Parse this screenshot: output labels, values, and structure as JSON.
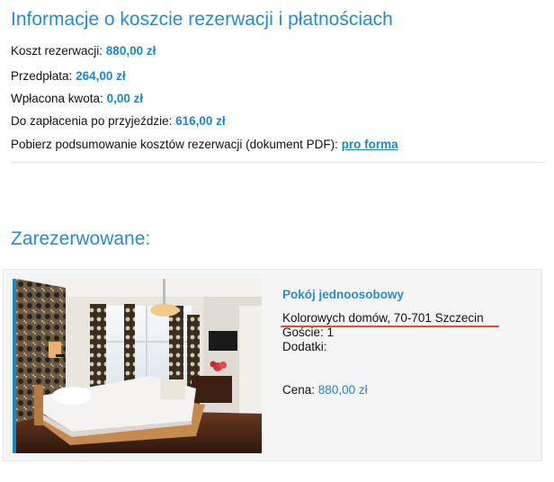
{
  "header": {
    "title": "Informacje o koszcie rezerwacji i płatnościach"
  },
  "costs": {
    "reservation_cost_label": "Koszt rezerwacji:",
    "reservation_cost_value": "880,00 zł",
    "prepayment_label": "Przedpłata:",
    "prepayment_value": "264,00 zł",
    "paid_amount_label": "Wpłacona kwota:",
    "paid_amount_value": "0,00 zł",
    "due_on_arrival_label": "Do zapłacenia po przyjeździe:",
    "due_on_arrival_value": "616,00 zł",
    "download_label": "Pobierz podsumowanie kosztów rezerwacji (dokument PDF):",
    "download_link": "pro forma"
  },
  "reserved": {
    "heading": "Zarezerwowane:",
    "room": {
      "title": "Pokój jednoosobowy",
      "address": "Kolorowych domów, 70-701 Szczecin",
      "guests": "Goście: 1",
      "extras": "Dodatki:",
      "price_label": "Cena:",
      "price_value": "880,00 zł"
    }
  },
  "colors": {
    "accent": "#2a8bc9",
    "value": "#1f85c9",
    "highlight_underline": "#e8473f"
  }
}
